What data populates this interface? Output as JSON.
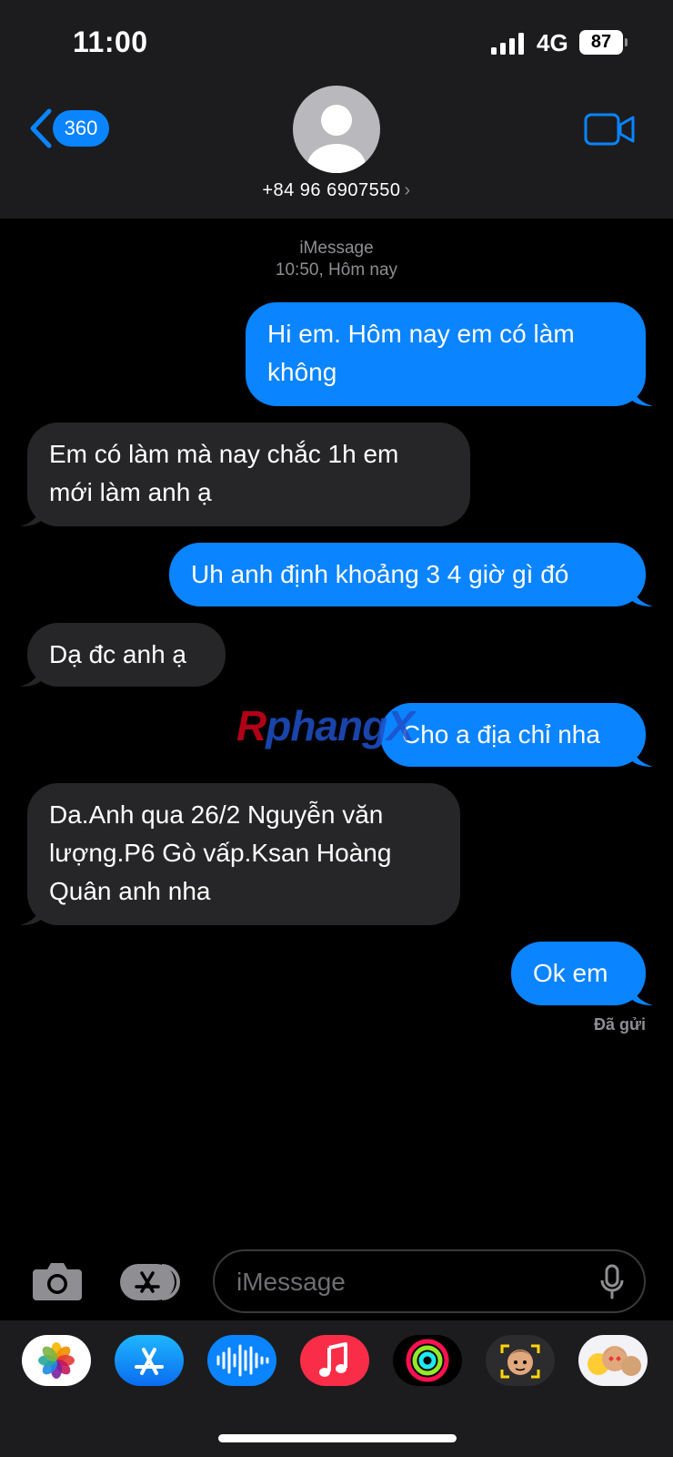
{
  "status_bar": {
    "time": "11:00",
    "network": "4G",
    "battery": "87"
  },
  "header": {
    "back_badge": "360",
    "contact": "+84 96 6907550",
    "chevron": "›"
  },
  "thread": {
    "service": "iMessage",
    "timestamp": "10:50, Hôm nay",
    "delivered": "Đã gửi",
    "messages": [
      {
        "direction": "out",
        "lines": [
          "Hi em. Hôm nay em có làm",
          "không"
        ]
      },
      {
        "direction": "in",
        "lines": [
          "Em có làm mà nay chắc 1h em",
          "mới làm anh ạ"
        ]
      },
      {
        "direction": "out",
        "lines": [
          "Uh anh định khoảng 3 4 giờ gì đó"
        ]
      },
      {
        "direction": "in",
        "lines": [
          "Dạ đc anh ạ"
        ]
      },
      {
        "direction": "out",
        "lines": [
          "Cho a địa chỉ nha"
        ]
      },
      {
        "direction": "in",
        "lines": [
          "Da.Anh qua 26/2 Nguyễn văn",
          "lượng.P6 Gò vấp.Ksan Hoàng",
          "Quân anh nha"
        ]
      },
      {
        "direction": "out",
        "lines": [
          "Ok em"
        ]
      }
    ]
  },
  "watermark": {
    "r": "R",
    "rest": "phangX"
  },
  "composer": {
    "placeholder": "iMessage"
  },
  "app_drawer": [
    "photos-icon",
    "app-store-icon",
    "audio-message-icon",
    "music-icon",
    "activity-icon",
    "memoji-icon",
    "memoji-stickers-icon"
  ],
  "colors": {
    "accent": "#0a84ff",
    "incoming": "#262628",
    "header_bg": "#1c1c1e"
  }
}
